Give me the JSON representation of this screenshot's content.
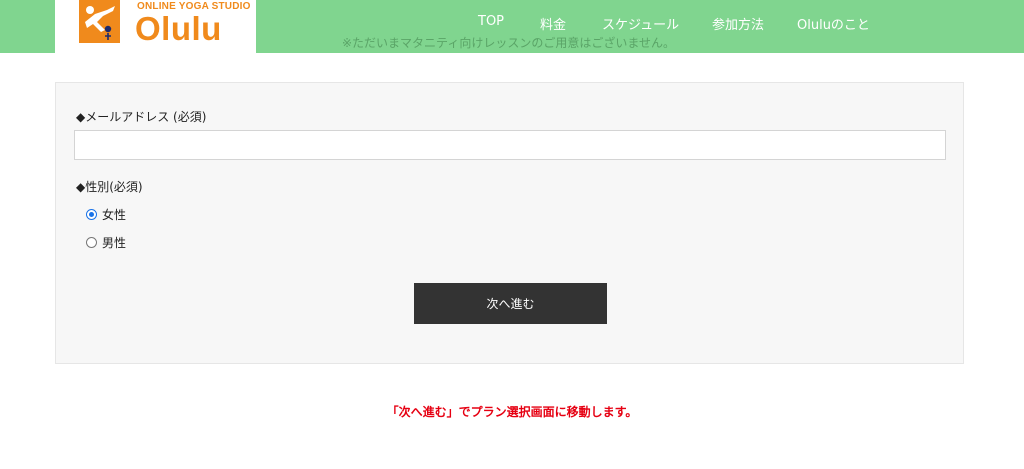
{
  "brand": {
    "tagline": "ONLINE YOGA STUDIO",
    "name": "Olulu",
    "logo_icon": "yoga-figure-icon",
    "accent_color": "#f08a1c"
  },
  "header": {
    "background_color": "#80d58f",
    "nav": [
      {
        "label": "TOP"
      },
      {
        "label": "料金"
      },
      {
        "label": "スケジュール"
      },
      {
        "label": "参加方法"
      },
      {
        "label": "Oluluのこと"
      }
    ],
    "notice": "※ただいまマタニティ向けレッスンのご用意はございません。"
  },
  "form": {
    "email_label": "◆メールアドレス (必須)",
    "email_value": "",
    "email_placeholder": "",
    "gender_label": "◆性別(必須)",
    "gender_options": [
      {
        "label": "女性",
        "checked": true
      },
      {
        "label": "男性",
        "checked": false
      }
    ],
    "submit_label": "次へ進む"
  },
  "footer_note": "「次へ進む」でプラン選択画面に移動します。"
}
